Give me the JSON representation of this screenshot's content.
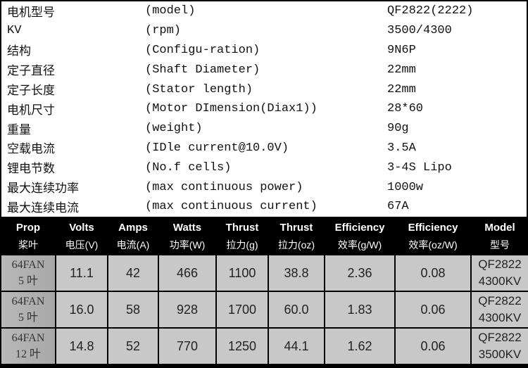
{
  "specs": [
    {
      "zh": "电机型号",
      "en": "(model)",
      "value": "QF2822(2222)"
    },
    {
      "zh": "KV",
      "en": "(rpm)",
      "value": "3500/4300"
    },
    {
      "zh": "结构",
      "en": "(Configu-ration)",
      "value": "9N6P"
    },
    {
      "zh": "定子直径",
      "en": "(Shaft Diameter)",
      "value": "22mm"
    },
    {
      "zh": "定子长度",
      "en": "(Stator length)",
      "value": "22mm"
    },
    {
      "zh": "电机尺寸",
      "en": "(Motor DImension(Diax1))",
      "value": "28*60"
    },
    {
      "zh": "重量",
      "en": "(weight)",
      "value": "90g"
    },
    {
      "zh": "空载电流",
      "en": "(IDle current@10.0V)",
      "value": "3.5A"
    },
    {
      "zh": "锂电节数",
      "en": "(No.f cells)",
      "value": "3-4S Lipo"
    },
    {
      "zh": "最大连续功率",
      "en": "(max continuous power)",
      "value": "1000w"
    },
    {
      "zh": "最大连续电流",
      "en": "(max continuous current)",
      "value": "67A"
    }
  ],
  "headers": [
    {
      "en": "Prop",
      "zh": "桨叶"
    },
    {
      "en": "Volts",
      "zh": "电压(V)"
    },
    {
      "en": "Amps",
      "zh": "电流(A)"
    },
    {
      "en": "Watts",
      "zh": "功率(W)"
    },
    {
      "en": "Thrust",
      "zh": "拉力(g)"
    },
    {
      "en": "Thrust",
      "zh": "拉力(oz)"
    },
    {
      "en": "Efficiency",
      "zh": "效率(g/W)"
    },
    {
      "en": "Efficiency",
      "zh": "效率(oz/W)"
    },
    {
      "en": "Model",
      "zh": "型号"
    }
  ],
  "rows": [
    {
      "prop": [
        "64FAN",
        "5 叶"
      ],
      "cells": [
        "11.1",
        "42",
        "466",
        "1100",
        "38.8",
        "2.36",
        "0.08"
      ],
      "model": [
        "QF2822",
        "4300KV"
      ]
    },
    {
      "prop": [
        "64FAN",
        "5 叶"
      ],
      "cells": [
        "16.0",
        "58",
        "928",
        "1700",
        "60.0",
        "1.83",
        "0.06"
      ],
      "model": [
        "QF2822",
        "4300KV"
      ]
    },
    {
      "prop": [
        "64FAN",
        "12 叶"
      ],
      "cells": [
        "14.8",
        "52",
        "770",
        "1250",
        "44.1",
        "1.62",
        "0.06"
      ],
      "model": [
        "QF2822",
        "3500KV"
      ]
    }
  ]
}
